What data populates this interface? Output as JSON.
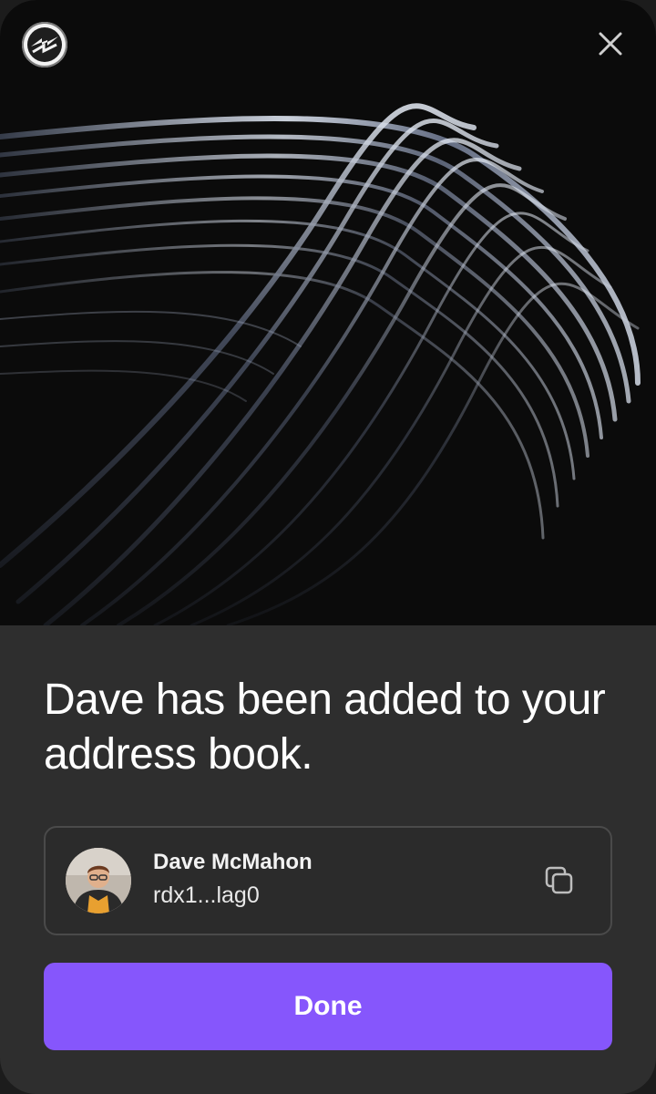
{
  "header": {
    "logo_icon": "radix-logo-icon",
    "close_icon": "close-icon"
  },
  "message": {
    "headline": "Dave has been added to your address book."
  },
  "contact": {
    "name": "Dave McMahon",
    "address": "rdx1...lag0",
    "copy_icon": "copy-icon"
  },
  "actions": {
    "done_label": "Done"
  },
  "colors": {
    "accent": "#8656fc",
    "panel": "#2e2e2e",
    "hero_bg": "#0b0b0b"
  }
}
